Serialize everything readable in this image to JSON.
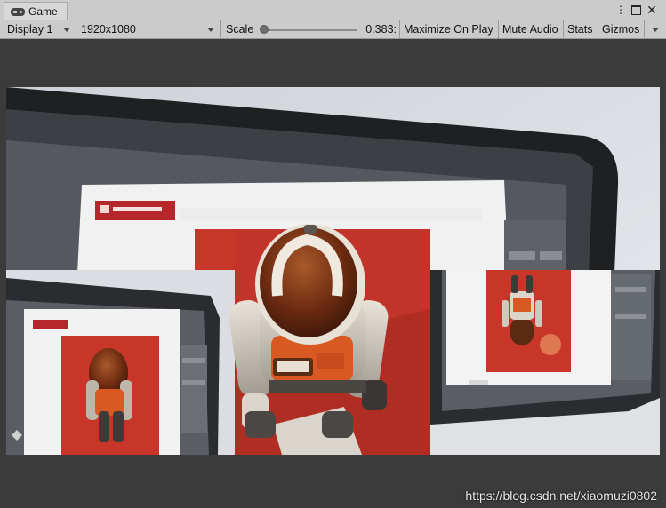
{
  "tab": {
    "title": "Game",
    "icon": "gamepad-icon"
  },
  "window_controls": [
    "kebab-menu-icon",
    "maximize-icon",
    "close-icon"
  ],
  "toolbar": {
    "display": "Display 1",
    "resolution": "1920x1080",
    "scale_label": "Scale",
    "scale_value": "0.383:",
    "scale_fraction": 0.0,
    "maximize": "Maximize On Play",
    "mute": "Mute Audio",
    "stats": "Stats",
    "gizmos": "Gizmos"
  },
  "watermark": "https://blog.csdn.net/xiaomuzi0802",
  "colors": {
    "toolbar_bg": "#cbcbcb",
    "view_bg": "#3b3b3b",
    "photo_red": "#c8362a",
    "suit_orange": "#d85a22"
  }
}
